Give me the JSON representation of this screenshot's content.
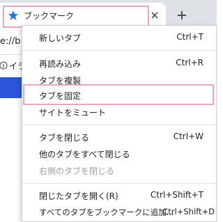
{
  "tab": {
    "title": "ブックマーク",
    "star_icon": "star-icon",
    "close_icon": "close-icon",
    "newtab_icon": "plus-icon",
    "highlight_color": "#e8a6c6"
  },
  "background": {
    "url_fragment": "e://b",
    "bookmark_label": "イラ",
    "band_color": "#2b55d6"
  },
  "menu": {
    "items": [
      {
        "label": "新しいタブ",
        "shortcut": "Ctrl+T",
        "enabled": true
      },
      {
        "label": "再読み込み",
        "shortcut": "Ctrl+R",
        "enabled": true
      },
      {
        "label": "タブを複製",
        "shortcut": "",
        "enabled": true
      },
      {
        "label": "タブを固定",
        "shortcut": "",
        "enabled": true
      },
      {
        "label": "サイトをミュート",
        "shortcut": "",
        "enabled": true
      },
      {
        "label": "タブを閉じる",
        "shortcut": "Ctrl+W",
        "enabled": true
      },
      {
        "label": "他のタブをすべて閉じる",
        "shortcut": "",
        "enabled": true
      },
      {
        "label": "右側のタブを閉じる",
        "shortcut": "",
        "enabled": false
      },
      {
        "label": "閉じたタブを開く(R)",
        "shortcut": "Ctrl+Shift+T",
        "enabled": true
      },
      {
        "label": "すべてのタブをブックマークに追加...",
        "shortcut": "Ctrl+Shift+D",
        "enabled": true
      }
    ]
  }
}
